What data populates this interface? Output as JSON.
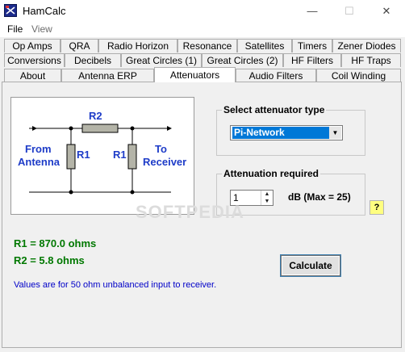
{
  "window": {
    "title": "HamCalc",
    "controls": {
      "minimize": "—",
      "maximize": "☐",
      "close": "✕"
    }
  },
  "menu": {
    "items": [
      "File",
      "View"
    ]
  },
  "tabs": {
    "row1": [
      "Op Amps",
      "QRA",
      "Radio Horizon",
      "Resonance",
      "Satellites",
      "Timers",
      "Zener Diodes"
    ],
    "row2": [
      "Conversions",
      "Decibels",
      "Great Circles (1)",
      "Great Circles (2)",
      "HF Filters",
      "HF Traps"
    ],
    "row3": [
      "About",
      "Antenna ERP",
      "Attenuators",
      "Audio Filters",
      "Coil Winding"
    ],
    "active": "Attenuators"
  },
  "diagram": {
    "r1_label": "R1",
    "r2_label": "R2",
    "from_line1": "From",
    "from_line2": "Antenna",
    "to_line1": "To",
    "to_line2": "Receiver",
    "label_color": "#1e3cc8",
    "resistor_color": "#b4b4a8"
  },
  "attenuator_type": {
    "label": "Select attenuator type",
    "selected": "Pi-Network"
  },
  "attenuation": {
    "label": "Attenuation required",
    "value": "1",
    "unit_text": "dB  (Max = 25)"
  },
  "help": {
    "label": "?"
  },
  "results": {
    "r1": "R1 = 870.0 ohms",
    "r2": "R2 = 5.8 ohms",
    "color": "#007800"
  },
  "calculate_label": "Calculate",
  "note": "Values are for 50 ohm unbalanced input to receiver.",
  "watermark": "SOFTPEDIA"
}
